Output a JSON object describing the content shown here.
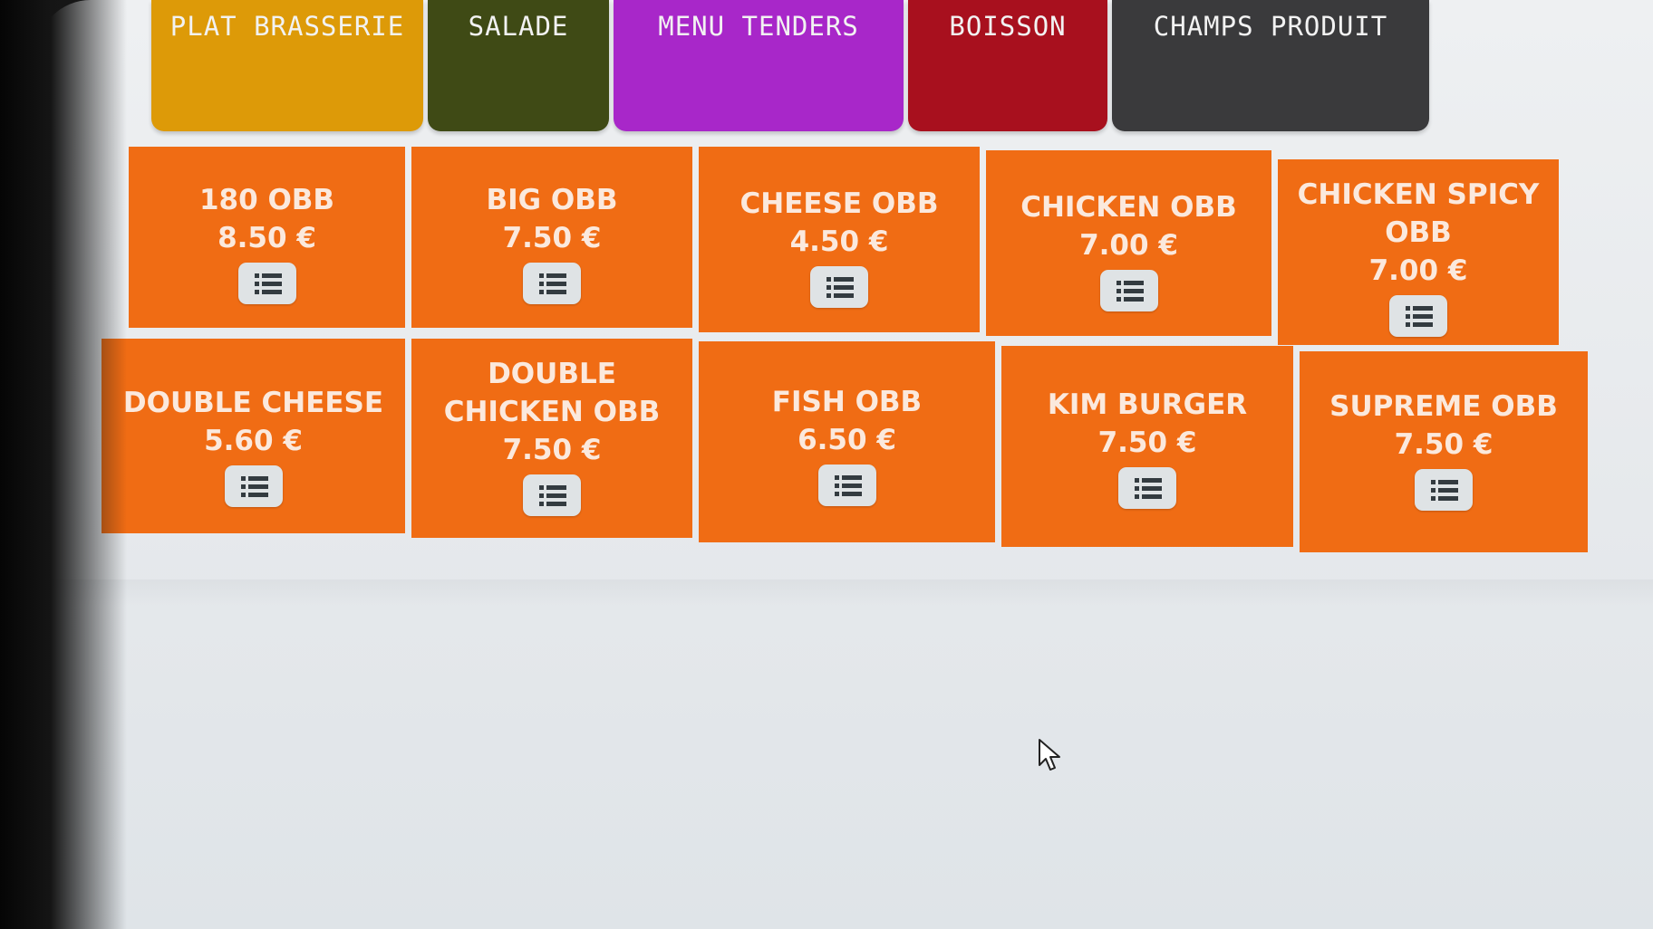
{
  "categories": [
    {
      "label": "PLAT BRASSERIE",
      "color": "#dd9a08"
    },
    {
      "label": "SALADE",
      "color": "#3f4a15"
    },
    {
      "label": "MENU TENDERS",
      "color": "#a827c9"
    },
    {
      "label": "BOISSON",
      "color": "#a8101e"
    },
    {
      "label": "CHAMPS PRODUIT",
      "color": "#3a3a3c"
    }
  ],
  "products": [
    {
      "name": "180 OBB",
      "price": "8.50 €"
    },
    {
      "name": "BIG OBB",
      "price": "7.50 €"
    },
    {
      "name": "CHEESE OBB",
      "price": "4.50 €"
    },
    {
      "name": "CHICKEN OBB",
      "price": "7.00 €"
    },
    {
      "name": "CHICKEN SPICY OBB",
      "price": "7.00 €"
    },
    {
      "name": "DOUBLE CHEESE",
      "price": "5.60 €"
    },
    {
      "name": "DOUBLE CHICKEN OBB",
      "price": "7.50 €"
    },
    {
      "name": "FISH OBB",
      "price": "6.50 €"
    },
    {
      "name": "KIM BURGER",
      "price": "7.50 €"
    },
    {
      "name": "SUPREME OBB",
      "price": "7.50 €"
    }
  ],
  "tile_color": "#f06c14",
  "icons": {
    "details": "list-icon",
    "pointer": "mouse-cursor-icon"
  }
}
